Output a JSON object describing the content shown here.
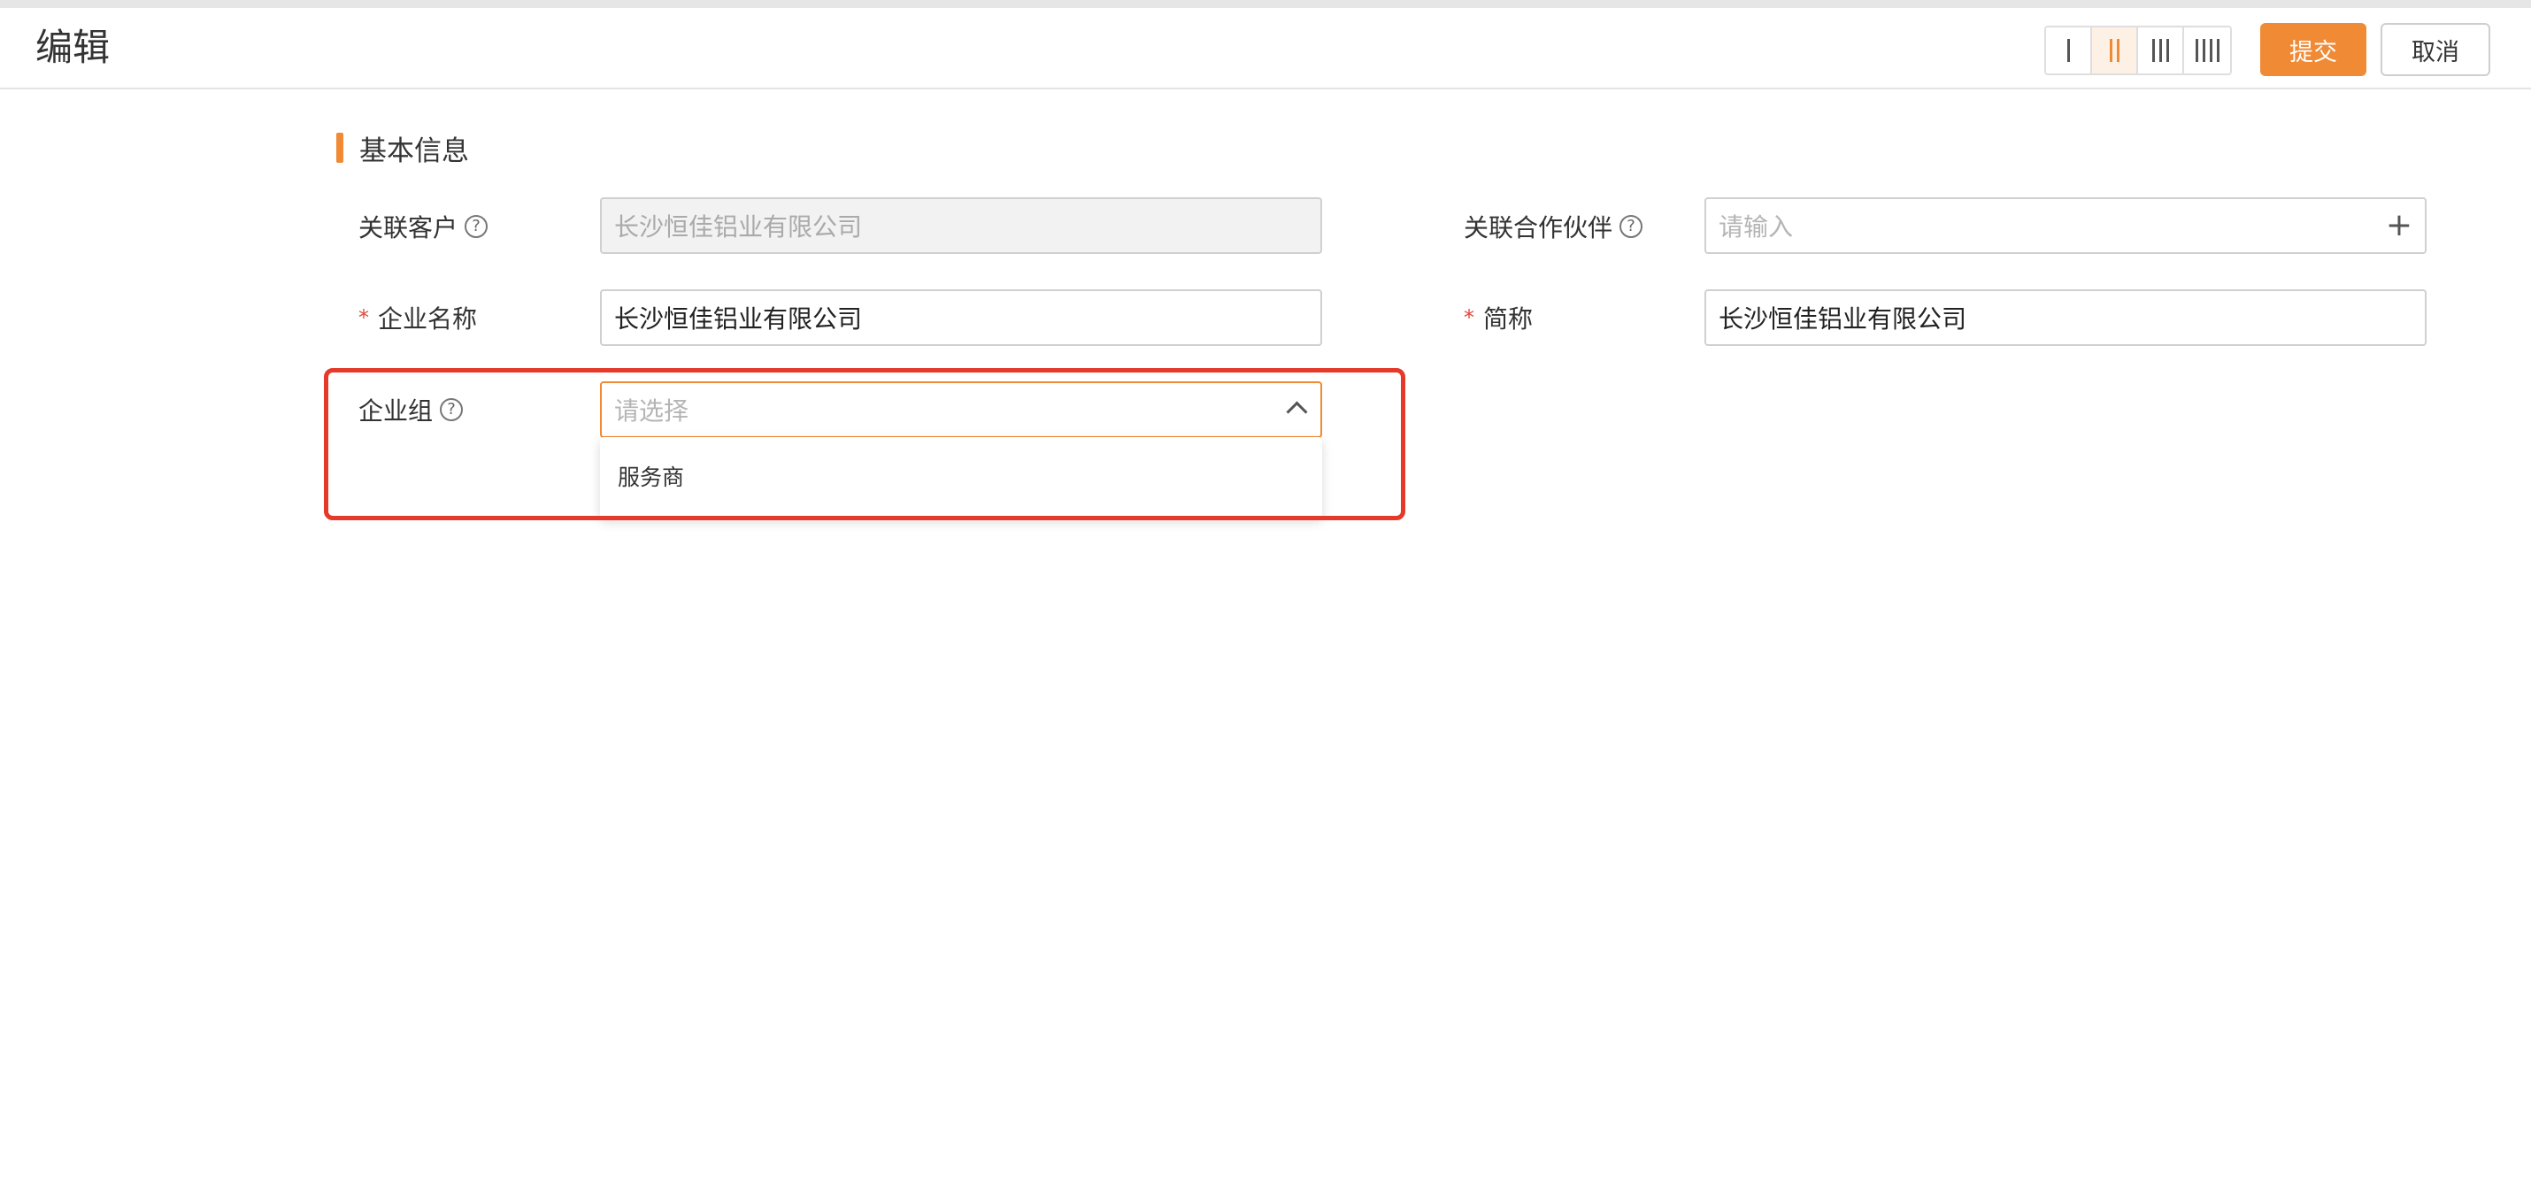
{
  "header": {
    "title": "编辑",
    "layout_options": [
      {
        "name": "layout-1-column",
        "bars": 1,
        "active": false
      },
      {
        "name": "layout-2-column",
        "bars": 2,
        "active": true
      },
      {
        "name": "layout-3-column",
        "bars": 3,
        "active": false
      },
      {
        "name": "layout-4-column",
        "bars": 4,
        "active": false
      }
    ],
    "submit_label": "提交",
    "cancel_label": "取消"
  },
  "section": {
    "title": "基本信息"
  },
  "form": {
    "related_customer": {
      "label": "关联客户",
      "help": "?",
      "value": "长沙恒佳铝业有限公司",
      "disabled": true
    },
    "related_partner": {
      "label": "关联合作伙伴",
      "help": "?",
      "placeholder": "请输入",
      "add_icon": "+"
    },
    "company_name": {
      "required_mark": "*",
      "label": "企业名称",
      "value": "长沙恒佳铝业有限公司"
    },
    "short_name": {
      "required_mark": "*",
      "label": "简称",
      "value": "长沙恒佳铝业有限公司"
    },
    "company_group": {
      "label": "企业组",
      "help": "?",
      "placeholder": "请选择",
      "expanded": true,
      "options": [
        "服务商"
      ]
    }
  },
  "colors": {
    "accent": "#f08a35",
    "highlight": "#e53a2a",
    "required": "#e0483a"
  }
}
